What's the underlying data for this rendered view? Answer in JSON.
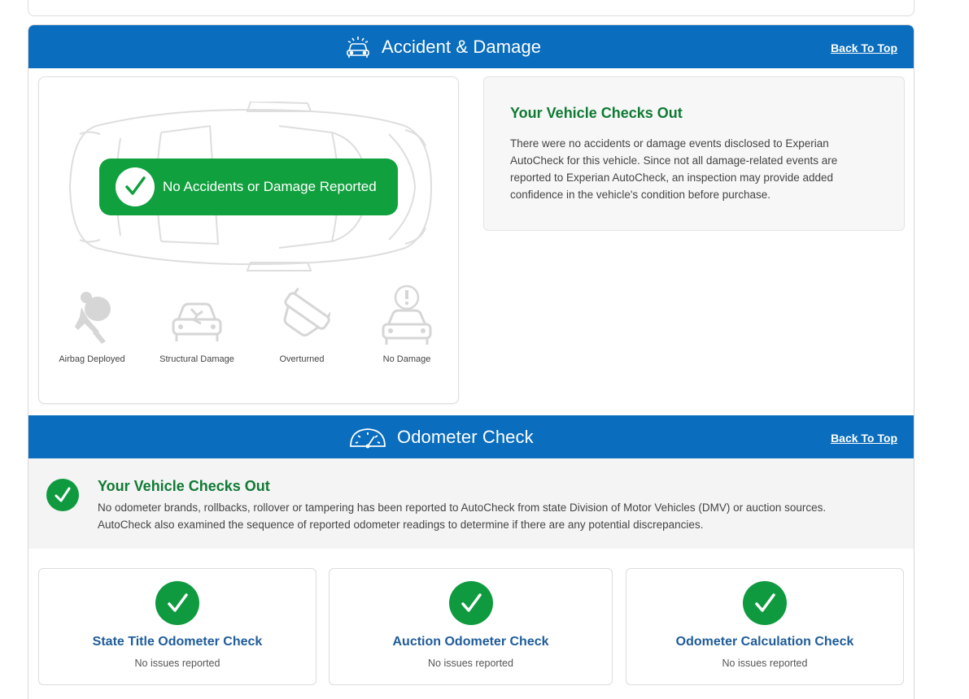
{
  "colors": {
    "band_blue": "#0a6dbd",
    "success_green": "#10a03e",
    "heading_green": "#0f7a34",
    "link_blue": "#1f5c99"
  },
  "accident": {
    "title": "Accident & Damage",
    "icon": "car-damage-icon",
    "back_to_top": "Back To Top",
    "badge_text": "No Accidents or Damage Reported",
    "categories": [
      {
        "label": "Airbag Deployed",
        "icon": "airbag-icon"
      },
      {
        "label": "Structural Damage",
        "icon": "structural-damage-icon"
      },
      {
        "label": "Overturned",
        "icon": "overturned-icon"
      },
      {
        "label": "No Damage",
        "icon": "no-damage-icon"
      }
    ],
    "info_heading": "Your Vehicle Checks Out",
    "info_text": "There were no accidents or damage events disclosed to Experian AutoCheck for this vehicle. Since not all damage-related events are reported to Experian AutoCheck, an inspection may provide added confidence in the vehicle's condition before purchase."
  },
  "odometer": {
    "title": "Odometer Check",
    "icon": "odometer-icon",
    "back_to_top": "Back To Top",
    "heading": "Your Vehicle Checks Out",
    "text": "No odometer brands, rollbacks, rollover or tampering has been reported to AutoCheck from state Division of Motor Vehicles (DMV) or auction sources. AutoCheck also examined the sequence of reported odometer readings to determine if there are any potential discrepancies.",
    "checks": [
      {
        "title": "State Title Odometer Check",
        "status": "No issues reported"
      },
      {
        "title": "Auction Odometer Check",
        "status": "No issues reported"
      },
      {
        "title": "Odometer Calculation Check",
        "status": "No issues reported"
      }
    ]
  }
}
